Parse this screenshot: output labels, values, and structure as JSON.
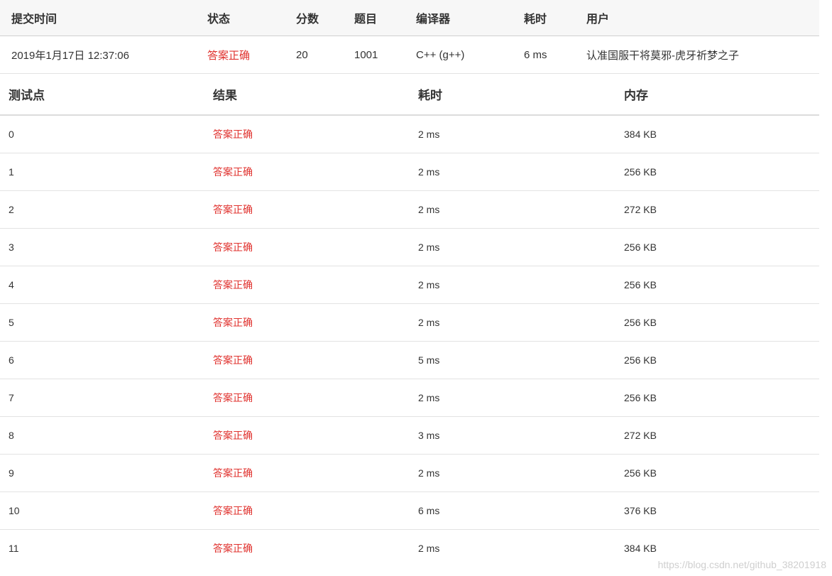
{
  "submission": {
    "headers": {
      "time": "提交时间",
      "status": "状态",
      "score": "分数",
      "problem": "题目",
      "compiler": "编译器",
      "elapsed": "耗时",
      "user": "用户"
    },
    "row": {
      "time": "2019年1月17日 12:37:06",
      "status": "答案正确",
      "score": "20",
      "problem": "1001",
      "compiler": "C++ (g++)",
      "elapsed": "6 ms",
      "user": "认准国服干将莫邪-虎牙祈梦之子"
    }
  },
  "testcases": {
    "headers": {
      "case": "测试点",
      "result": "结果",
      "elapsed": "耗时",
      "memory": "内存"
    },
    "rows": [
      {
        "case": "0",
        "result": "答案正确",
        "elapsed": "2 ms",
        "memory": "384 KB"
      },
      {
        "case": "1",
        "result": "答案正确",
        "elapsed": "2 ms",
        "memory": "256 KB"
      },
      {
        "case": "2",
        "result": "答案正确",
        "elapsed": "2 ms",
        "memory": "272 KB"
      },
      {
        "case": "3",
        "result": "答案正确",
        "elapsed": "2 ms",
        "memory": "256 KB"
      },
      {
        "case": "4",
        "result": "答案正确",
        "elapsed": "2 ms",
        "memory": "256 KB"
      },
      {
        "case": "5",
        "result": "答案正确",
        "elapsed": "2 ms",
        "memory": "256 KB"
      },
      {
        "case": "6",
        "result": "答案正确",
        "elapsed": "5 ms",
        "memory": "256 KB"
      },
      {
        "case": "7",
        "result": "答案正确",
        "elapsed": "2 ms",
        "memory": "256 KB"
      },
      {
        "case": "8",
        "result": "答案正确",
        "elapsed": "3 ms",
        "memory": "272 KB"
      },
      {
        "case": "9",
        "result": "答案正确",
        "elapsed": "2 ms",
        "memory": "256 KB"
      },
      {
        "case": "10",
        "result": "答案正确",
        "elapsed": "6 ms",
        "memory": "376 KB"
      },
      {
        "case": "11",
        "result": "答案正确",
        "elapsed": "2 ms",
        "memory": "384 KB"
      }
    ]
  },
  "watermark": "https://blog.csdn.net/github_38201918",
  "colors": {
    "accepted": "#e0322e",
    "header_bg": "#f7f7f7"
  }
}
